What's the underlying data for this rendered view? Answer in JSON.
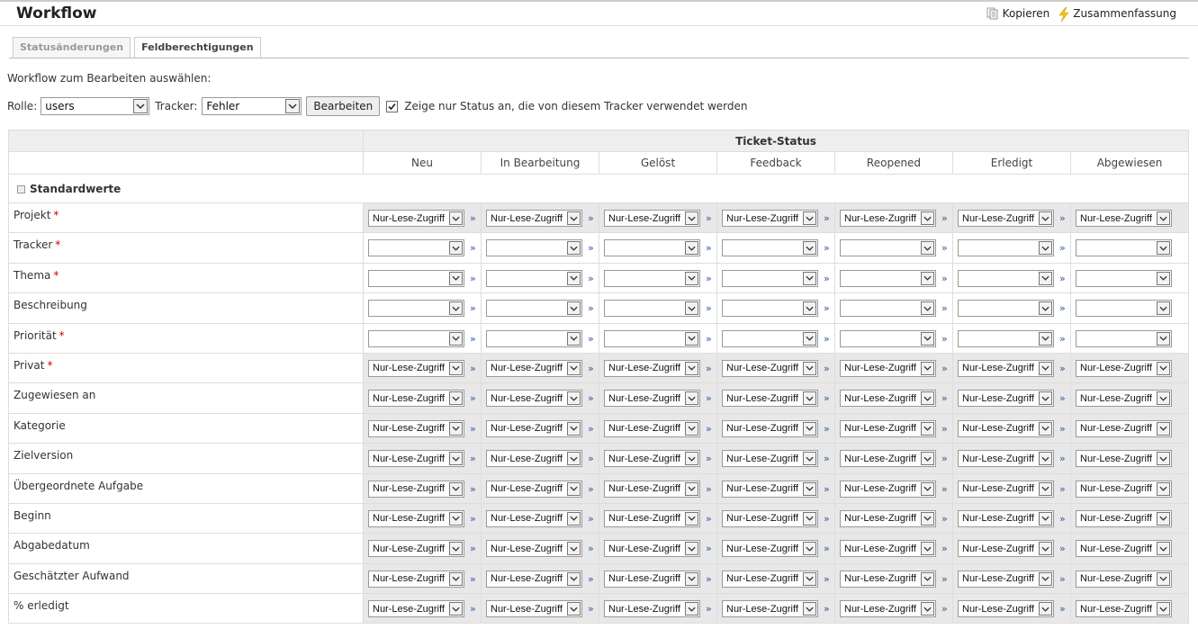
{
  "page": {
    "title": "Workflow",
    "actions": {
      "copy": "Kopieren",
      "summary": "Zusammenfassung"
    }
  },
  "tabs": [
    {
      "label": "Statusänderungen",
      "active": false
    },
    {
      "label": "Feldberechtigungen",
      "active": true
    }
  ],
  "form": {
    "select_label": "Workflow zum Bearbeiten auswählen:",
    "role_label": "Rolle:",
    "role_value": "users",
    "tracker_label": "Tracker:",
    "tracker_value": "Fehler",
    "edit_button": "Bearbeiten",
    "only_used_checked": true,
    "only_used_label": "Zeige nur Status an, die von diesem Tracker verwendet werden"
  },
  "table": {
    "status_header": "Ticket-Status",
    "statuses": [
      "Neu",
      "In Bearbeitung",
      "Gelöst",
      "Feedback",
      "Reopened",
      "Erledigt",
      "Abgewiesen"
    ],
    "group_label": "Standardwerte",
    "readonly_value": "Nur-Lese-Zugriff",
    "copy_glyph": "»",
    "fields": [
      {
        "name": "Projekt",
        "required": true,
        "value": "Nur-Lese-Zugriff"
      },
      {
        "name": "Tracker",
        "required": true,
        "value": ""
      },
      {
        "name": "Thema",
        "required": true,
        "value": ""
      },
      {
        "name": "Beschreibung",
        "required": false,
        "value": ""
      },
      {
        "name": "Priorität",
        "required": true,
        "value": ""
      },
      {
        "name": "Privat",
        "required": true,
        "value": "Nur-Lese-Zugriff"
      },
      {
        "name": "Zugewiesen an",
        "required": false,
        "value": "Nur-Lese-Zugriff"
      },
      {
        "name": "Kategorie",
        "required": false,
        "value": "Nur-Lese-Zugriff"
      },
      {
        "name": "Zielversion",
        "required": false,
        "value": "Nur-Lese-Zugriff"
      },
      {
        "name": "Übergeordnete Aufgabe",
        "required": false,
        "value": "Nur-Lese-Zugriff"
      },
      {
        "name": "Beginn",
        "required": false,
        "value": "Nur-Lese-Zugriff"
      },
      {
        "name": "Abgabedatum",
        "required": false,
        "value": "Nur-Lese-Zugriff"
      },
      {
        "name": "Geschätzter Aufwand",
        "required": false,
        "value": "Nur-Lese-Zugriff"
      },
      {
        "name": "% erledigt",
        "required": false,
        "value": "Nur-Lese-Zugriff"
      }
    ]
  },
  "colors": {
    "readonly_bg": "#e8e8e8",
    "required_marker": "#cc0000",
    "link": "#2a5a9c",
    "summary_icon": "#f0c419"
  }
}
